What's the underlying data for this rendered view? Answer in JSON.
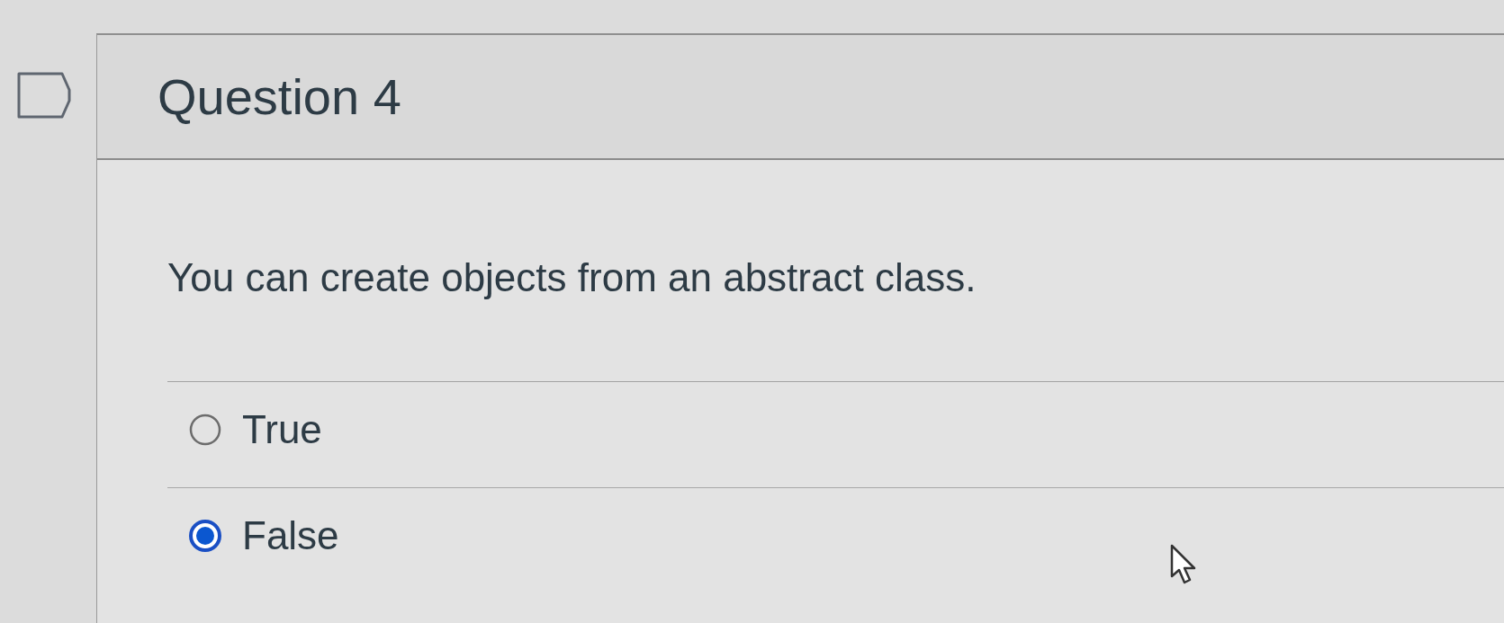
{
  "question": {
    "flagged": false,
    "title": "Question 4",
    "prompt": "You can create objects from an abstract class.",
    "options": [
      {
        "label": "True",
        "selected": false
      },
      {
        "label": "False",
        "selected": true
      }
    ]
  }
}
